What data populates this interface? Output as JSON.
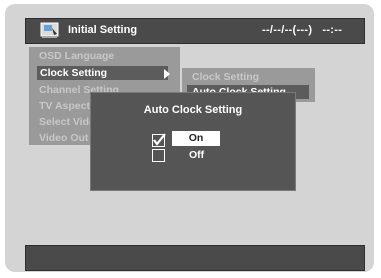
{
  "header": {
    "title": "Initial Setting",
    "datetime": "--/--/--(---)   --:--",
    "icon": "setup-icon"
  },
  "main_menu": {
    "items": [
      {
        "label": "OSD Language"
      },
      {
        "label": "Clock Setting",
        "selected": true
      },
      {
        "label": "Channel Setting"
      },
      {
        "label": "TV Aspect"
      },
      {
        "label": "Select Video"
      },
      {
        "label": "Video Out"
      }
    ]
  },
  "clock_menu": {
    "items": [
      {
        "label": "Clock Setting"
      },
      {
        "label": "Auto Clock Setting",
        "selected": true
      }
    ]
  },
  "dialog": {
    "title": "Auto Clock Setting",
    "options": [
      {
        "label": "On",
        "checked": true,
        "selected": true
      },
      {
        "label": "Off",
        "checked": false,
        "selected": false
      }
    ]
  },
  "colors": {
    "background": "#d4d4d4",
    "bar": "#4a4a4a",
    "dialog": "#555555",
    "menu": "#9a9a9a",
    "highlight": "#5c5c5c"
  }
}
